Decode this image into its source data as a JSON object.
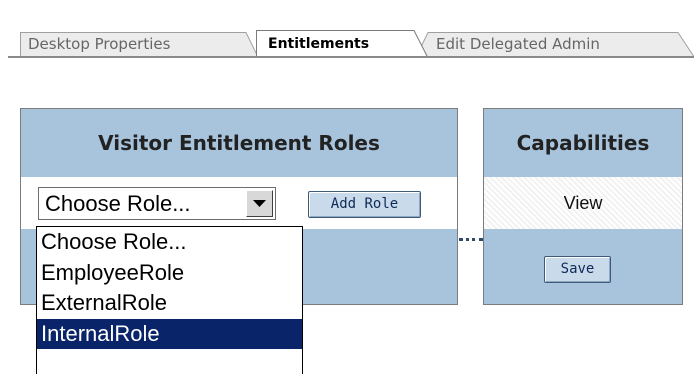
{
  "tabs": [
    {
      "label": "Desktop Properties",
      "active": false
    },
    {
      "label": "Entitlements",
      "active": true
    },
    {
      "label": "Edit Delegated Admin",
      "active": false
    }
  ],
  "roles_panel": {
    "title": "Visitor Entitlement Roles",
    "select_value": "Choose Role...",
    "add_role_label": "Add Role"
  },
  "capabilities_panel": {
    "title": "Capabilities",
    "capability": "View",
    "save_label": "Save"
  },
  "dropdown": {
    "options": [
      "Choose Role...",
      "EmployeeRole",
      "ExternalRole",
      "InternalRole"
    ],
    "highlighted": "InternalRole"
  },
  "icons": {
    "select_arrow": "chevron-down-icon"
  },
  "colors": {
    "panel_header": "#a8c4dd",
    "highlight": "#0a246a",
    "button_bg": "#c9dbea"
  }
}
